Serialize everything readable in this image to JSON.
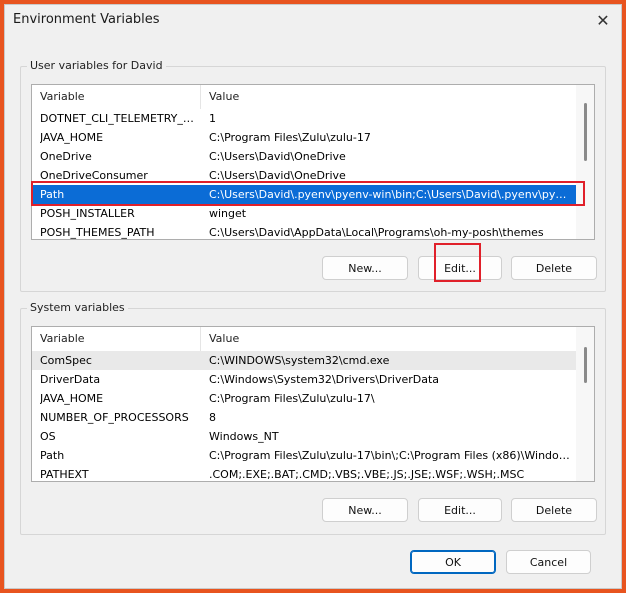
{
  "window": {
    "title": "Environment Variables"
  },
  "user_section": {
    "label": "User variables for David",
    "columns": [
      "Variable",
      "Value"
    ],
    "rows": [
      {
        "variable": "DOTNET_CLI_TELEMETRY_O...",
        "value": "1"
      },
      {
        "variable": "JAVA_HOME",
        "value": "C:\\Program Files\\Zulu\\zulu-17"
      },
      {
        "variable": "OneDrive",
        "value": "C:\\Users\\David\\OneDrive"
      },
      {
        "variable": "OneDriveConsumer",
        "value": "C:\\Users\\David\\OneDrive"
      },
      {
        "variable": "Path",
        "value": "C:\\Users\\David\\.pyenv\\pyenv-win\\bin;C:\\Users\\David\\.pyenv\\pyen..."
      },
      {
        "variable": "POSH_INSTALLER",
        "value": "winget"
      },
      {
        "variable": "POSH_THEMES_PATH",
        "value": "C:\\Users\\David\\AppData\\Local\\Programs\\oh-my-posh\\themes"
      }
    ],
    "buttons": {
      "new": "New...",
      "edit": "Edit...",
      "delete": "Delete"
    }
  },
  "system_section": {
    "label": "System variables",
    "columns": [
      "Variable",
      "Value"
    ],
    "rows": [
      {
        "variable": "ComSpec",
        "value": "C:\\WINDOWS\\system32\\cmd.exe"
      },
      {
        "variable": "DriverData",
        "value": "C:\\Windows\\System32\\Drivers\\DriverData"
      },
      {
        "variable": "JAVA_HOME",
        "value": "C:\\Program Files\\Zulu\\zulu-17\\"
      },
      {
        "variable": "NUMBER_OF_PROCESSORS",
        "value": "8"
      },
      {
        "variable": "OS",
        "value": "Windows_NT"
      },
      {
        "variable": "Path",
        "value": "C:\\Program Files\\Zulu\\zulu-17\\bin\\;C:\\Program Files (x86)\\Window..."
      },
      {
        "variable": "PATHEXT",
        "value": ".COM;.EXE;.BAT;.CMD;.VBS;.VBE;.JS;.JSE;.WSF;.WSH;.MSC"
      }
    ],
    "buttons": {
      "new": "New...",
      "edit": "Edit...",
      "delete": "Delete"
    }
  },
  "footer": {
    "ok": "OK",
    "cancel": "Cancel"
  },
  "colors": {
    "selection": "#0b6cd6",
    "annotation": "#e0202a",
    "frame": "#e8541f"
  }
}
